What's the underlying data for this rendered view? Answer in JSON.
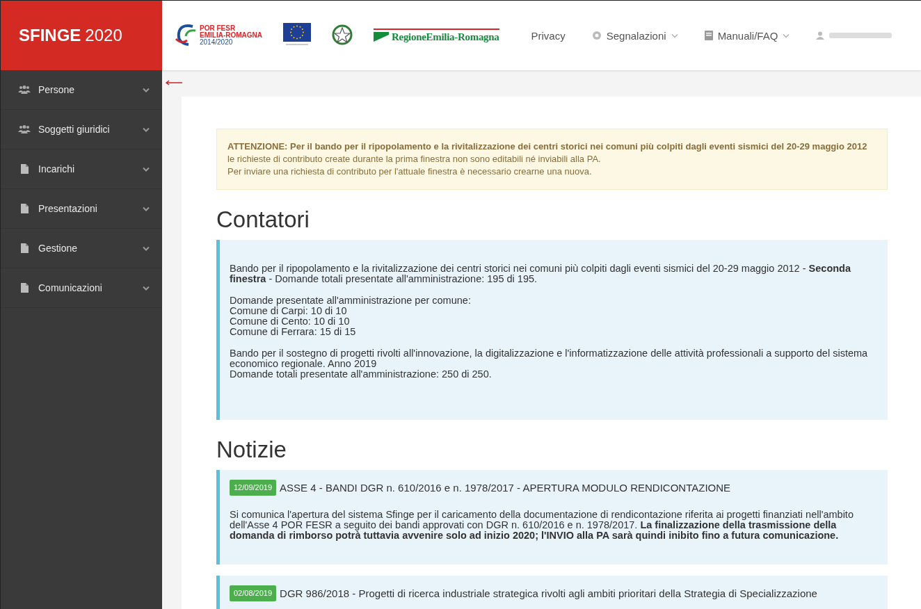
{
  "brand": {
    "name": "SFINGE",
    "year": "2020"
  },
  "header": {
    "program_logo": [
      "POR FESR",
      "EMILIA-ROMAGNA",
      "2014/2020"
    ],
    "region_logo": "RegioneEmilia-Romagna",
    "nav": [
      {
        "kind": "link",
        "label": "Privacy"
      },
      {
        "kind": "support",
        "label": "Segnalazioni"
      },
      {
        "kind": "manual",
        "label": "Manuali/FAQ"
      },
      {
        "kind": "user"
      }
    ]
  },
  "sidebar": {
    "items": [
      {
        "kind": "group",
        "label": "Persone"
      },
      {
        "kind": "group",
        "label": "Soggetti giuridici"
      },
      {
        "kind": "document",
        "label": "Incarichi"
      },
      {
        "kind": "document",
        "label": "Presentazioni"
      },
      {
        "kind": "document",
        "label": "Gestione"
      },
      {
        "kind": "document",
        "label": "Comunicazioni"
      }
    ]
  },
  "alert": {
    "paragraphs": [
      "**ATTENZIONE: Per il bando per il ripopolamento e la rivitalizzazione dei centri storici nei comuni più colpiti dagli eventi sismici del 20-29 maggio 2012** le richieste di contributo create durante la prima finestra non sono editabili né inviabili alla PA.",
      "Per inviare una richiesta di contributo per l'attuale finestra è necessario crearne una nuova."
    ]
  },
  "counters": {
    "title": "Contatori",
    "paragraphs": [
      [
        "Bando per il ripopolamento e la rivitalizzazione dei centri storici nei comuni più colpiti dagli eventi sismici del 20-29 maggio 2012 - **Seconda finestra** - Domande totali presentate all'amministrazione: 195 di 195."
      ],
      [
        "Domande presentate all'amministrazione per comune:",
        "Comune di Carpi: 10 di 10",
        "Comune di Cento: 10 di 10",
        "Comune di Ferrara: 15 di 15"
      ],
      [
        "Bando per il sostegno di progetti rivolti all'innovazione, la digitalizzazione e l'informatizzazione delle attività professionali a supporto del sistema economico regionale. Anno 2019",
        "Domande totali presentate all'amministrazione: 250 di 250."
      ]
    ]
  },
  "news": {
    "title": "Notizie",
    "items": [
      {
        "date": "12/09/2019",
        "title": "ASSE 4 - BANDI DGR n. 610/2016 e n. 1978/2017 - APERTURA MODULO RENDICONTAZIONE",
        "body": "Si comunica l'apertura del sistema Sfinge per il caricamento della documentazione di rendicontazione riferita ai progetti finanziati nell'ambito dell'Asse 4 POR FESR a seguito dei bandi approvati con DGR n. 610/2016 e n. 1978/2017. **La finalizzazione della trasmissione della domanda di rimborso potrà tuttavia avvenire solo ad inizio 2020; l'INVIO alla PA sarà quindi inibito fino a futura comunicazione.**"
      },
      {
        "date": "02/08/2019",
        "title": "DGR 986/2018 - Progetti di ricerca industriale strategica rivolti agli ambiti prioritari della Strategia di Specializzazione"
      }
    ]
  }
}
